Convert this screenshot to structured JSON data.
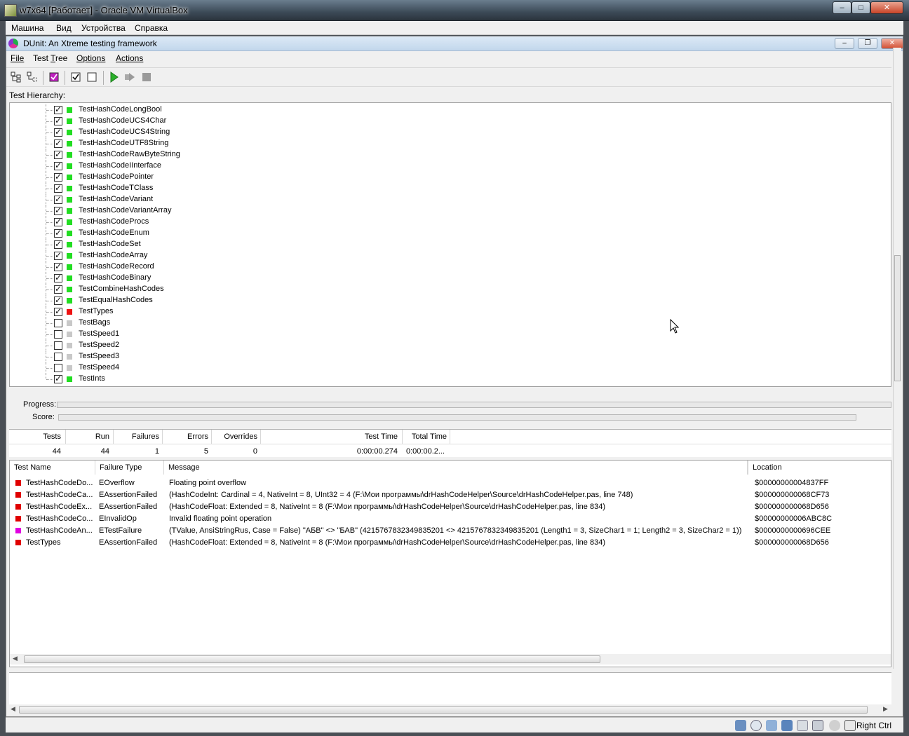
{
  "vbox": {
    "title": "w7x64 [Работает] - Oracle VM VirtualBox",
    "menu": [
      "Машина",
      "Вид",
      "Устройства",
      "Справка"
    ],
    "host_key": "Right Ctrl"
  },
  "dunit": {
    "title": "DUnit: An Xtreme testing framework",
    "menu": [
      {
        "label": "File",
        "hotkey": "F"
      },
      {
        "label": "Test Tree",
        "hotkey": "T"
      },
      {
        "label": "Options",
        "hotkey": "O"
      },
      {
        "label": "Actions",
        "hotkey": "A"
      }
    ],
    "hierarchy_label": "Test Hierarchy:",
    "tree": [
      {
        "name": "TestHashCodeLongBool",
        "checked": true,
        "status": "pass"
      },
      {
        "name": "TestHashCodeUCS4Char",
        "checked": true,
        "status": "pass"
      },
      {
        "name": "TestHashCodeUCS4String",
        "checked": true,
        "status": "pass"
      },
      {
        "name": "TestHashCodeUTF8String",
        "checked": true,
        "status": "pass"
      },
      {
        "name": "TestHashCodeRawByteString",
        "checked": true,
        "status": "pass"
      },
      {
        "name": "TestHashCodeIInterface",
        "checked": true,
        "status": "pass"
      },
      {
        "name": "TestHashCodePointer",
        "checked": true,
        "status": "pass"
      },
      {
        "name": "TestHashCodeTClass",
        "checked": true,
        "status": "pass"
      },
      {
        "name": "TestHashCodeVariant",
        "checked": true,
        "status": "pass"
      },
      {
        "name": "TestHashCodeVariantArray",
        "checked": true,
        "status": "pass"
      },
      {
        "name": "TestHashCodeProcs",
        "checked": true,
        "status": "pass"
      },
      {
        "name": "TestHashCodeEnum",
        "checked": true,
        "status": "pass"
      },
      {
        "name": "TestHashCodeSet",
        "checked": true,
        "status": "pass"
      },
      {
        "name": "TestHashCodeArray",
        "checked": true,
        "status": "pass"
      },
      {
        "name": "TestHashCodeRecord",
        "checked": true,
        "status": "pass"
      },
      {
        "name": "TestHashCodeBinary",
        "checked": true,
        "status": "pass"
      },
      {
        "name": "TestCombineHashCodes",
        "checked": true,
        "status": "pass"
      },
      {
        "name": "TestEqualHashCodes",
        "checked": true,
        "status": "pass"
      },
      {
        "name": "TestTypes",
        "checked": true,
        "status": "fail"
      },
      {
        "name": "TestBags",
        "checked": false,
        "status": "skip"
      },
      {
        "name": "TestSpeed1",
        "checked": false,
        "status": "skip"
      },
      {
        "name": "TestSpeed2",
        "checked": false,
        "status": "skip"
      },
      {
        "name": "TestSpeed3",
        "checked": false,
        "status": "skip"
      },
      {
        "name": "TestSpeed4",
        "checked": false,
        "status": "skip"
      },
      {
        "name": "TestInts",
        "checked": true,
        "status": "pass"
      }
    ],
    "progress_label": "Progress:",
    "score_label": "Score:",
    "stats": {
      "headers": [
        "Tests",
        "Run",
        "Failures",
        "Errors",
        "Overrides",
        "Test Time",
        "Total Time"
      ],
      "values": [
        "44",
        "44",
        "1",
        "5",
        "0",
        "0:00:00.274",
        "0:00:00.2..."
      ]
    },
    "failures": {
      "headers": [
        "Test Name",
        "Failure Type",
        "Message",
        "Location"
      ],
      "rows": [
        {
          "name": "TestHashCodeDo...",
          "type": "EOverflow",
          "message": "Floating point overflow",
          "location": "$00000000004837FF",
          "kind": "error"
        },
        {
          "name": "TestHashCodeCa...",
          "type": "EAssertionFailed",
          "message": "(HashCodeInt: Cardinal = 4, NativeInt = 8, UInt32 = 4 (F:\\Мои программы\\drHashCodeHelper\\Source\\drHashCodeHelper.pas, line 748)",
          "location": "$000000000068CF73",
          "kind": "error"
        },
        {
          "name": "TestHashCodeEx...",
          "type": "EAssertionFailed",
          "message": "(HashCodeFloat: Extended = 8, NativeInt = 8 (F:\\Мои программы\\drHashCodeHelper\\Source\\drHashCodeHelper.pas, line 834)",
          "location": "$000000000068D656",
          "kind": "error"
        },
        {
          "name": "TestHashCodeCo...",
          "type": "EInvalidOp",
          "message": "Invalid floating point operation",
          "location": "$00000000006ABC8C",
          "kind": "error"
        },
        {
          "name": "TestHashCodeAn...",
          "type": "ETestFailure",
          "message": "(TValue, AnsiStringRus, Case = False) \"АБВ\" <> \"БАВ\" (4215767832349835201 <> 4215767832349835201 (Length1 = 3, SizeChar1 = 1; Length2 = 3, SizeChar2 = 1))",
          "location": "$0000000000696CEE",
          "kind": "failure"
        },
        {
          "name": "TestTypes",
          "type": "EAssertionFailed",
          "message": "(HashCodeFloat: Extended = 8, NativeInt = 8 (F:\\Мои программы\\drHashCodeHelper\\Source\\drHashCodeHelper.pas, line 834)",
          "location": "$000000000068D656",
          "kind": "error"
        }
      ]
    }
  },
  "colors": {
    "pass": "#22dd22",
    "fail": "#ee1111",
    "skip": "#c8c8c8",
    "error": "#e00000",
    "failure": "#e000e0"
  }
}
